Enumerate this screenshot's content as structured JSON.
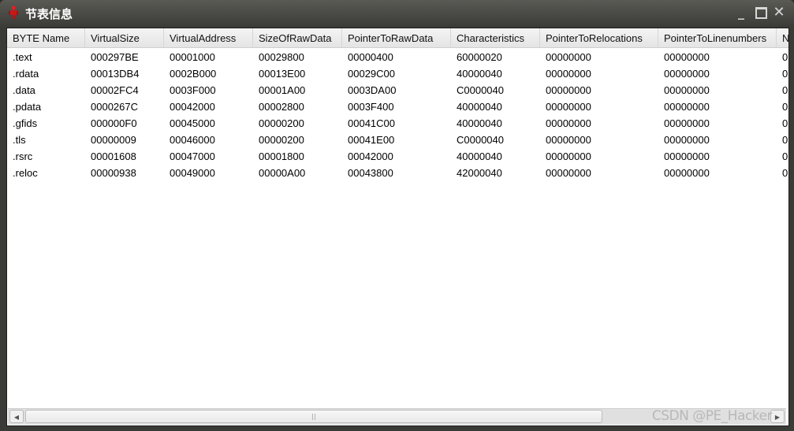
{
  "window": {
    "title": "节表信息",
    "minimize_icon": "minimize-icon",
    "maximize_icon": "maximize-icon",
    "close_icon": "close-icon",
    "app_icon": "red-robot-icon"
  },
  "table": {
    "columns": [
      "BYTE Name",
      "VirtualSize",
      "VirtualAddress",
      "SizeOfRawData",
      "PointerToRawData",
      "Characteristics",
      "PointerToRelocations",
      "PointerToLinenumbers",
      "N"
    ],
    "rows": [
      [
        ".text",
        "000297BE",
        "00001000",
        "00029800",
        "00000400",
        "60000020",
        "00000000",
        "00000000",
        "0"
      ],
      [
        ".rdata",
        "00013DB4",
        "0002B000",
        "00013E00",
        "00029C00",
        "40000040",
        "00000000",
        "00000000",
        "0"
      ],
      [
        ".data",
        "00002FC4",
        "0003F000",
        "00001A00",
        "0003DA00",
        "C0000040",
        "00000000",
        "00000000",
        "0"
      ],
      [
        ".pdata",
        "0000267C",
        "00042000",
        "00002800",
        "0003F400",
        "40000040",
        "00000000",
        "00000000",
        "0"
      ],
      [
        ".gfids",
        "000000F0",
        "00045000",
        "00000200",
        "00041C00",
        "40000040",
        "00000000",
        "00000000",
        "0"
      ],
      [
        ".tls",
        "00000009",
        "00046000",
        "00000200",
        "00041E00",
        "C0000040",
        "00000000",
        "00000000",
        "0"
      ],
      [
        ".rsrc",
        "00001608",
        "00047000",
        "00001800",
        "00042000",
        "40000040",
        "00000000",
        "00000000",
        "0"
      ],
      [
        ".reloc",
        "00000938",
        "00049000",
        "00000A00",
        "00043800",
        "42000040",
        "00000000",
        "00000000",
        "0"
      ]
    ]
  },
  "watermark": "CSDN @PE_Hacker",
  "colors": {
    "titlebar": "#3b3b37",
    "accent_icon": "#d42020"
  }
}
